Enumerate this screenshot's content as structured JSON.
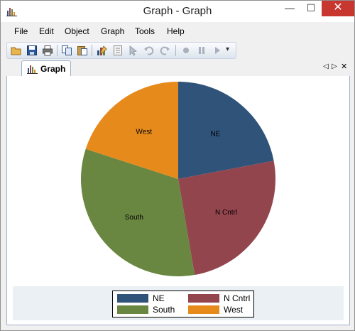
{
  "window": {
    "title": "Graph - Graph",
    "minimize": "—",
    "maximize": "☐",
    "close": "✕"
  },
  "menu": [
    "File",
    "Edit",
    "Object",
    "Graph",
    "Tools",
    "Help"
  ],
  "toolbar": {
    "overflow": "▾"
  },
  "tabs": [
    {
      "label": "Graph",
      "active": true
    }
  ],
  "tab_nav": {
    "prev": "◁",
    "next": "▷",
    "close": "✕"
  },
  "colors": {
    "ne": "#2f5379",
    "ncntrl": "#93454e",
    "south": "#6a8742",
    "west": "#e68a1c"
  },
  "chart_data": {
    "type": "pie",
    "title": "",
    "slices": [
      {
        "label": "NE",
        "value": 22.0,
        "color": "#2f5379"
      },
      {
        "label": "N Cntrl",
        "value": 25.3,
        "color": "#93454e"
      },
      {
        "label": "South",
        "value": 32.7,
        "color": "#6a8742"
      },
      {
        "label": "West",
        "value": 20.0,
        "color": "#e68a1c"
      }
    ],
    "legend": {
      "placement": "bottom",
      "entries": [
        "NE",
        "N Cntrl",
        "South",
        "West"
      ]
    }
  }
}
